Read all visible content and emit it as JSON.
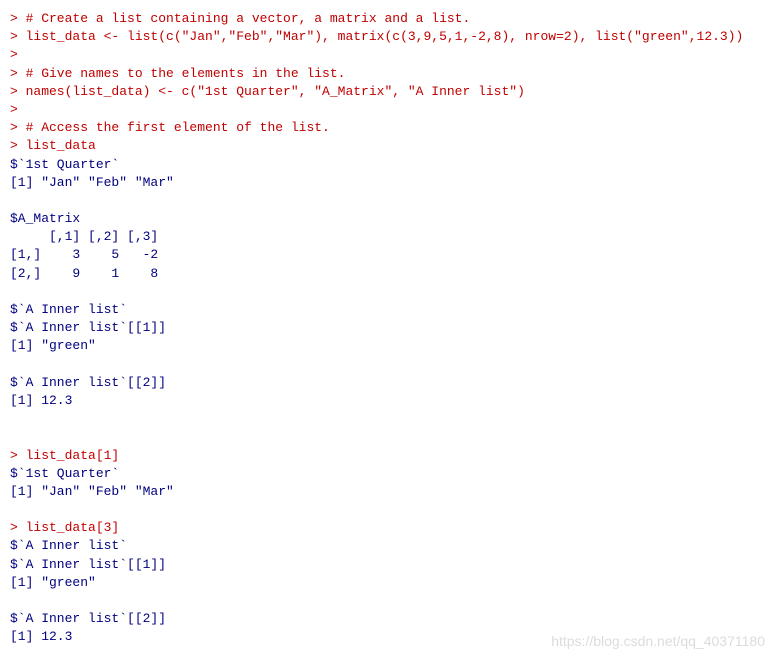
{
  "lines": [
    {
      "cls": "input",
      "text": "> # Create a list containing a vector, a matrix and a list."
    },
    {
      "cls": "input",
      "text": "> list_data <- list(c(\"Jan\",\"Feb\",\"Mar\"), matrix(c(3,9,5,1,-2,8), nrow=2), list(\"green\",12.3))"
    },
    {
      "cls": "input",
      "text": "> "
    },
    {
      "cls": "input",
      "text": "> # Give names to the elements in the list."
    },
    {
      "cls": "input",
      "text": "> names(list_data) <- c(\"1st Quarter\", \"A_Matrix\", \"A Inner list\")"
    },
    {
      "cls": "input",
      "text": "> "
    },
    {
      "cls": "input",
      "text": "> # Access the first element of the list."
    },
    {
      "cls": "input",
      "text": "> list_data"
    },
    {
      "cls": "output",
      "text": "$`1st Quarter`"
    },
    {
      "cls": "output",
      "text": "[1] \"Jan\" \"Feb\" \"Mar\""
    },
    {
      "cls": "output",
      "text": ""
    },
    {
      "cls": "output",
      "text": "$A_Matrix"
    },
    {
      "cls": "output",
      "text": "     [,1] [,2] [,3]"
    },
    {
      "cls": "output",
      "text": "[1,]    3    5   -2"
    },
    {
      "cls": "output",
      "text": "[2,]    9    1    8"
    },
    {
      "cls": "output",
      "text": ""
    },
    {
      "cls": "output",
      "text": "$`A Inner list`"
    },
    {
      "cls": "output",
      "text": "$`A Inner list`[[1]]"
    },
    {
      "cls": "output",
      "text": "[1] \"green\""
    },
    {
      "cls": "output",
      "text": ""
    },
    {
      "cls": "output",
      "text": "$`A Inner list`[[2]]"
    },
    {
      "cls": "output",
      "text": "[1] 12.3"
    },
    {
      "cls": "output",
      "text": ""
    },
    {
      "cls": "output",
      "text": ""
    },
    {
      "cls": "input",
      "text": "> list_data[1]"
    },
    {
      "cls": "output",
      "text": "$`1st Quarter`"
    },
    {
      "cls": "output",
      "text": "[1] \"Jan\" \"Feb\" \"Mar\""
    },
    {
      "cls": "output",
      "text": ""
    },
    {
      "cls": "input",
      "text": "> list_data[3]"
    },
    {
      "cls": "output",
      "text": "$`A Inner list`"
    },
    {
      "cls": "output",
      "text": "$`A Inner list`[[1]]"
    },
    {
      "cls": "output",
      "text": "[1] \"green\""
    },
    {
      "cls": "output",
      "text": ""
    },
    {
      "cls": "output",
      "text": "$`A Inner list`[[2]]"
    },
    {
      "cls": "output",
      "text": "[1] 12.3"
    }
  ],
  "watermark": "https://blog.csdn.net/qq_40371180"
}
